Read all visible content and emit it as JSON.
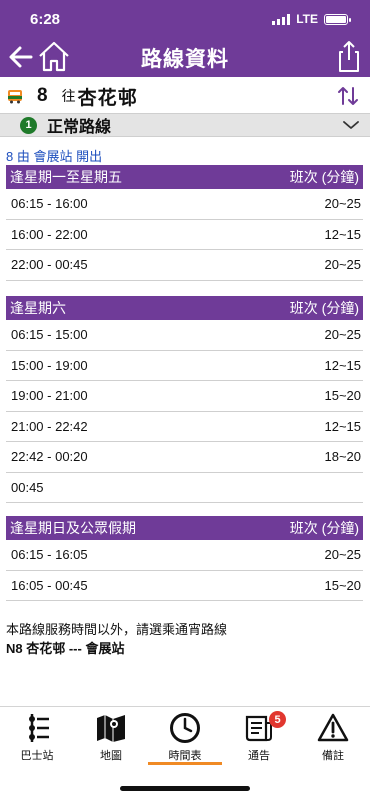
{
  "status": {
    "time": "6:28",
    "network": "LTE"
  },
  "header": {
    "title": "路線資料"
  },
  "route": {
    "number": "8",
    "towards_label": "往",
    "destination": "杏花邨"
  },
  "normal_route": {
    "index": "1",
    "label": "正常路線"
  },
  "departure": "8 由 會展站 開出",
  "tables": [
    {
      "heading": "逢星期一至星期五",
      "freq_label": "班次 (分鐘)",
      "rows": [
        {
          "time": "06:15 - 16:00",
          "freq": "20~25"
        },
        {
          "time": "16:00 - 22:00",
          "freq": "12~15"
        },
        {
          "time": "22:00 - 00:45",
          "freq": "20~25"
        }
      ]
    },
    {
      "heading": "逢星期六",
      "freq_label": "班次 (分鐘)",
      "rows": [
        {
          "time": "06:15 - 15:00",
          "freq": "20~25"
        },
        {
          "time": "15:00 - 19:00",
          "freq": "12~15"
        },
        {
          "time": "19:00 - 21:00",
          "freq": "15~20"
        },
        {
          "time": "21:00 - 22:42",
          "freq": "12~15"
        },
        {
          "time": "22:42 - 00:20",
          "freq": "18~20"
        },
        {
          "time": "00:45",
          "freq": ""
        }
      ]
    },
    {
      "heading": "逢星期日及公眾假期",
      "freq_label": "班次 (分鐘)",
      "rows": [
        {
          "time": "06:15 - 16:05",
          "freq": "20~25"
        },
        {
          "time": "16:05 - 00:45",
          "freq": "15~20"
        }
      ]
    }
  ],
  "note": {
    "line1": "本路線服務時間以外，請選乘通宵路線",
    "line2": "N8 杏花邨 --- 會展站"
  },
  "tabs": [
    {
      "label": "巴士站",
      "icon": "bus-stop-icon"
    },
    {
      "label": "地圖",
      "icon": "map-icon"
    },
    {
      "label": "時間表",
      "icon": "clock-icon",
      "active": true
    },
    {
      "label": "通告",
      "icon": "notice-icon",
      "badge": "5"
    },
    {
      "label": "備註",
      "icon": "warning-icon"
    }
  ],
  "colors": {
    "primary": "#6f3b98",
    "accent": "#f08a24",
    "badge": "#e1372f",
    "link": "#1e4fbe",
    "route_green": "#1f7a2a"
  }
}
